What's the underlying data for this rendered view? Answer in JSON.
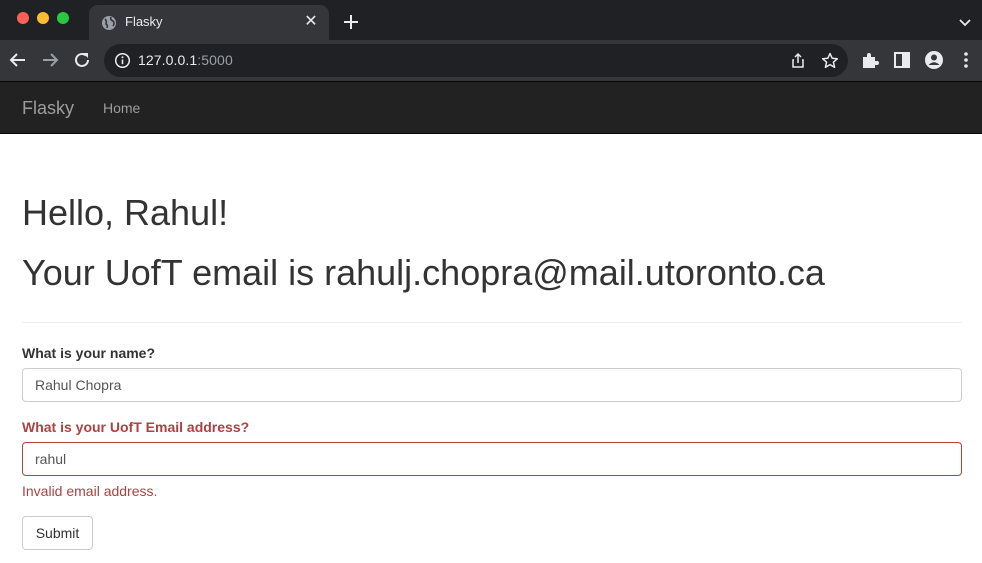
{
  "browser": {
    "tab": {
      "title": "Flasky",
      "favicon": "globe-icon"
    },
    "url": {
      "host": "127.0.0.1",
      "port": ":5000"
    },
    "colors": {
      "tabstrip": "#202124",
      "toolbar": "#35363a",
      "omnibox": "#202124"
    }
  },
  "navbar": {
    "brand": "Flasky",
    "links": [
      {
        "label": "Home"
      }
    ]
  },
  "main": {
    "greeting": "Hello, Rahul!",
    "email_line": "Your UofT email is rahulj.chopra@mail.utoronto.ca"
  },
  "form": {
    "name_label": "What is your name?",
    "name_value": "Rahul Chopra",
    "email_label": "What is your UofT Email address?",
    "email_value": "rahul",
    "email_error": "Invalid email address.",
    "submit_label": "Submit",
    "error_color": "#a94442"
  }
}
